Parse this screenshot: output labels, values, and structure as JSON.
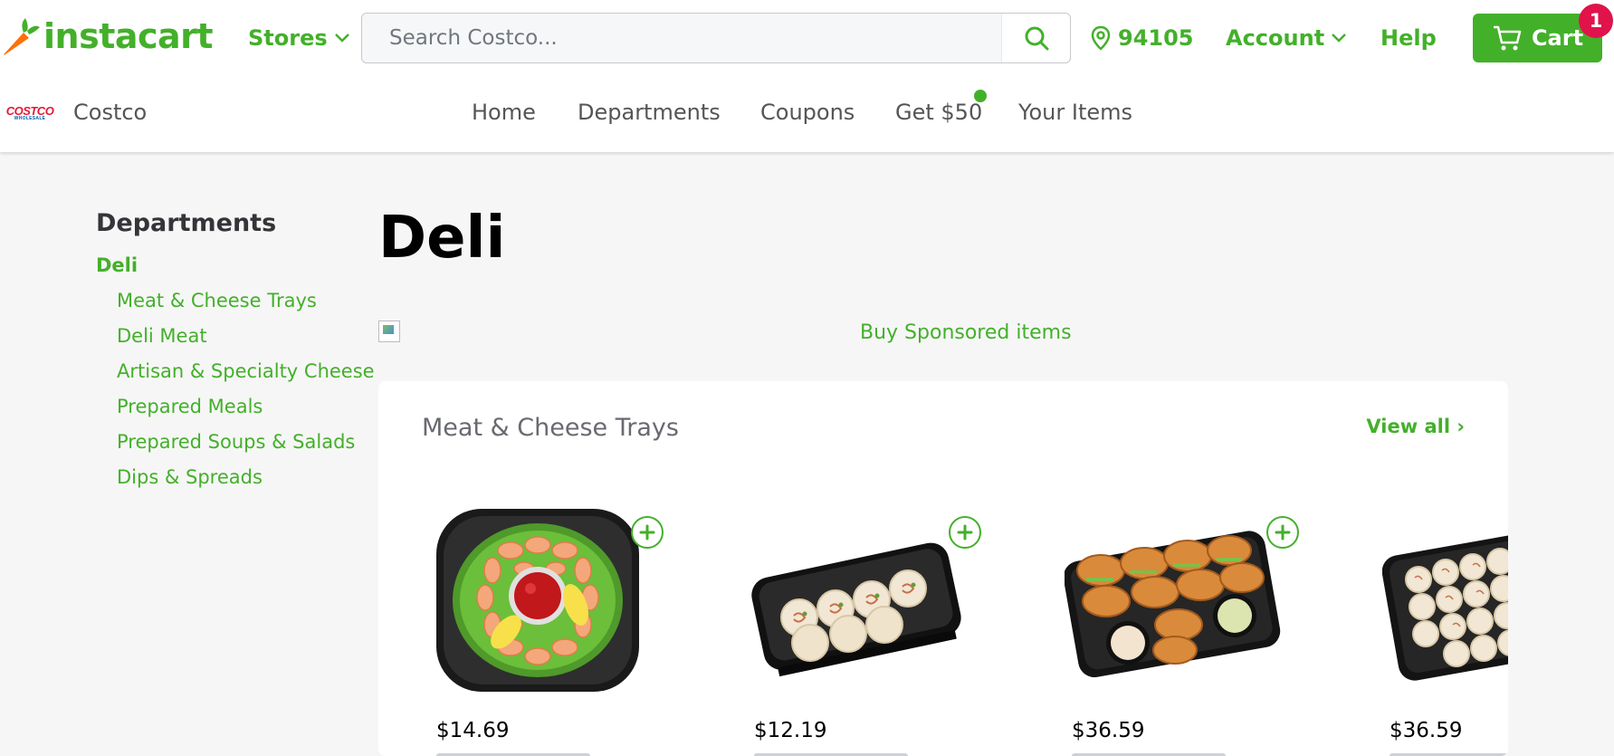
{
  "brand": {
    "name": "instacart",
    "accent": "#43b02a",
    "badge_color": "#e0134a"
  },
  "header": {
    "stores_label": "Stores",
    "search_placeholder": "Search Costco...",
    "zip": "94105",
    "account_label": "Account",
    "help_label": "Help",
    "cart_label": "Cart",
    "cart_count": "1"
  },
  "store": {
    "name": "Costco",
    "logo_text": "COSTCO",
    "logo_subtext": "WHOLESALE"
  },
  "subnav": {
    "items": [
      "Home",
      "Departments",
      "Coupons",
      "Get $50",
      "Your Items"
    ]
  },
  "sidebar": {
    "title": "Departments",
    "active": "Deli",
    "items": [
      "Meat & Cheese Trays",
      "Deli Meat",
      "Artisan & Specialty Cheese",
      "Prepared Meals",
      "Prepared Soups & Salads",
      "Dips & Spreads"
    ]
  },
  "main": {
    "title": "Deli",
    "sponsored_link": "Buy Sponsored items",
    "section": {
      "title": "Meat & Cheese Trays",
      "view_all": "View all ›",
      "products": [
        {
          "price": "$14.69",
          "image": "shrimp-platter-image"
        },
        {
          "price": "$12.19",
          "image": "pinwheel-tray-image"
        },
        {
          "price": "$36.59",
          "image": "croissant-sandwich-tray-image"
        },
        {
          "price": "$36.59",
          "image": "pinwheel-platter-image"
        }
      ]
    }
  }
}
